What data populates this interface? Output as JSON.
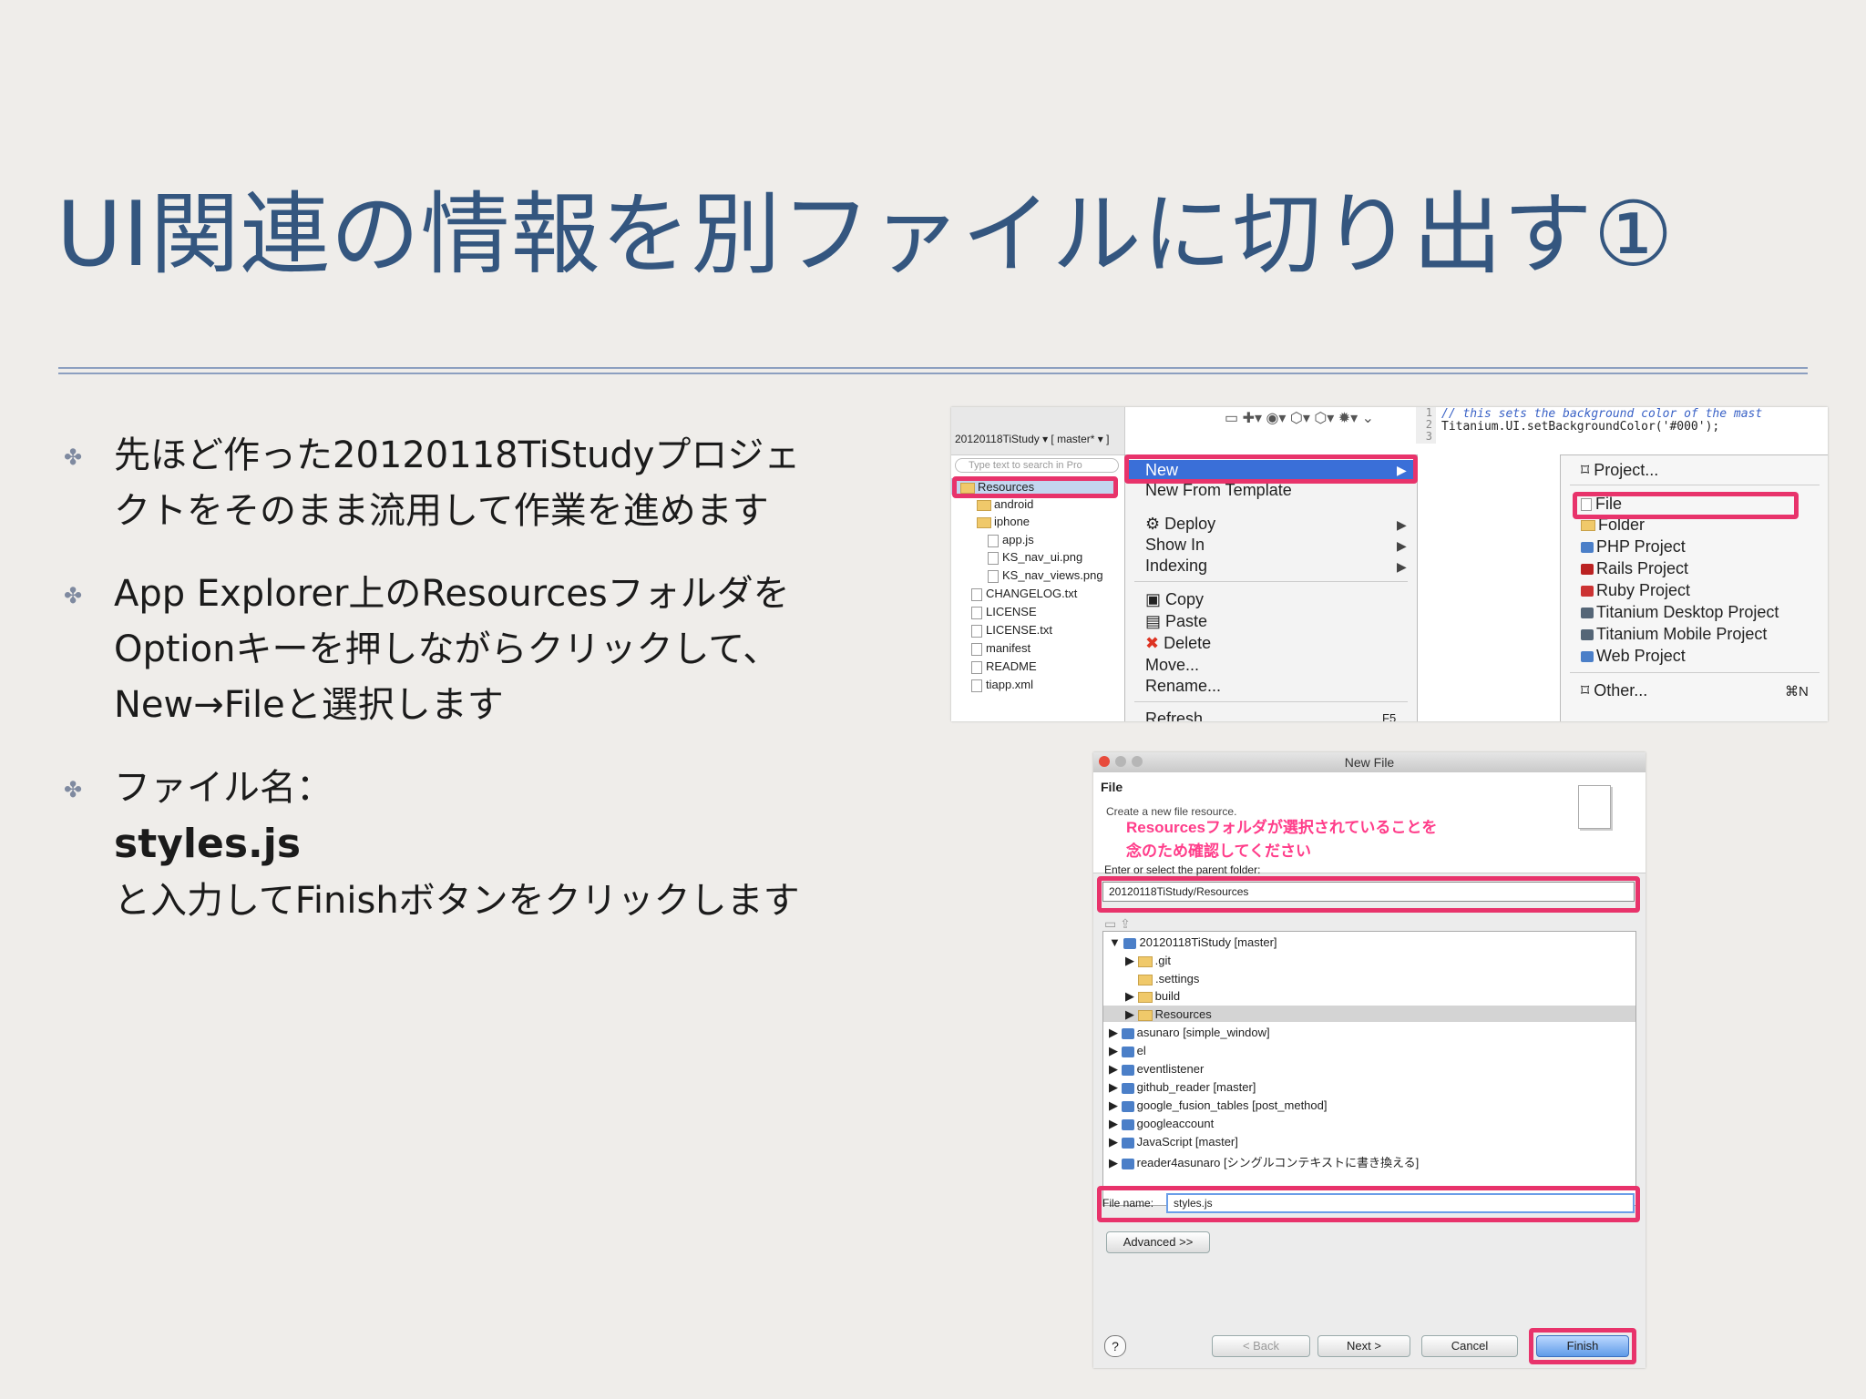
{
  "slide": {
    "title": "UI関連の情報を別ファイルに切り出す①",
    "bullets": [
      {
        "lines": [
          "先ほど作った20120118TiStudyプロジェ",
          "クトをそのまま流用して作業を進めます"
        ]
      },
      {
        "lines": [
          "App Explorer上のResourcesフォルダを",
          "Optionキーを押しながらクリックして、",
          "New→Fileと選択します"
        ]
      },
      {
        "line1": "ファイル名：",
        "bold": "styles.js",
        "line3": "と入力してFinishボタンをクリックします"
      }
    ],
    "bullet_glyph": "✤"
  },
  "explorer_shot": {
    "toolbar_branch": "20120118TiStudy ▾ [ master* ▾ ]",
    "search_placeholder": "Type text to search in Pro",
    "code_lines": [
      "// this sets the background color of the mast",
      "Titanium.UI.setBackgroundColor('#000');"
    ],
    "line_numbers": [
      "1",
      "2",
      "3"
    ],
    "tree": [
      "Resources",
      "android",
      "iphone",
      "app.js",
      "KS_nav_ui.png",
      "KS_nav_views.png",
      "CHANGELOG.txt",
      "LICENSE",
      "LICENSE.txt",
      "manifest",
      "README",
      "tiapp.xml"
    ],
    "context_menu": [
      "New",
      "New From Template",
      "Deploy",
      "Show In",
      "Indexing",
      "Copy",
      "Paste",
      "Delete",
      "Move...",
      "Rename...",
      "Refresh"
    ],
    "submenu": [
      "Project...",
      "File",
      "Folder",
      "PHP Project",
      "Rails Project",
      "Ruby Project",
      "Titanium Desktop Project",
      "Titanium Mobile Project",
      "Web Project",
      "Other..."
    ],
    "other_shortcut": "⌘N",
    "refresh_shortcut": "F5"
  },
  "newfile_shot": {
    "window_title": "New File",
    "heading": "File",
    "description": "Create a new file resource.",
    "annotation_line1": "Resourcesフォルダが選択されていることを",
    "annotation_line2": "念のため確認してください",
    "parent_label": "Enter or select the parent folder:",
    "parent_value": "20120118TiStudy/Resources",
    "tree": [
      "20120118TiStudy [master]",
      ".git",
      ".settings",
      "build",
      "Resources",
      "asunaro [simple_window]",
      "el",
      "eventlistener",
      "github_reader [master]",
      "google_fusion_tables [post_method]",
      "googleaccount",
      "JavaScript [master]",
      "reader4asunaro [シングルコンテキストに書き換える]"
    ],
    "filename_label": "File name:",
    "filename_value": "styles.js",
    "advanced_label": "Advanced >>",
    "buttons": {
      "back": "< Back",
      "next": "Next >",
      "cancel": "Cancel",
      "finish": "Finish"
    },
    "help": "?"
  }
}
